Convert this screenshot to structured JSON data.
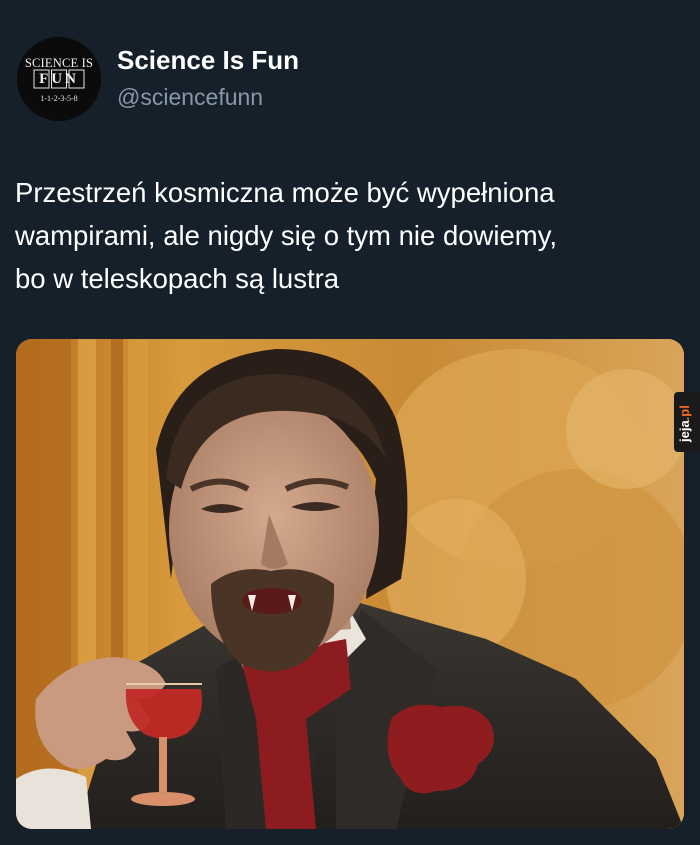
{
  "tweet": {
    "author": {
      "display_name": "Science Is Fun",
      "handle": "@sciencefunn",
      "avatar": {
        "line1": "SCIENCE IS",
        "line2": "FUN",
        "line3": "1-1-2-3-5-8"
      }
    },
    "text_lines": [
      "Przestrzeń kosmiczna może być wypełniona",
      "wampirami, ale nigdy się o tym nie dowiemy,",
      "bo w teleskopach są lustra"
    ],
    "media": {
      "description_icon": "meme-image"
    }
  },
  "watermark": {
    "main": "jeja",
    "accent": ".pl"
  },
  "colors": {
    "background": "#15202b",
    "handle": "#8899a6",
    "text": "#ffffff",
    "watermark_accent": "#f26b21"
  }
}
